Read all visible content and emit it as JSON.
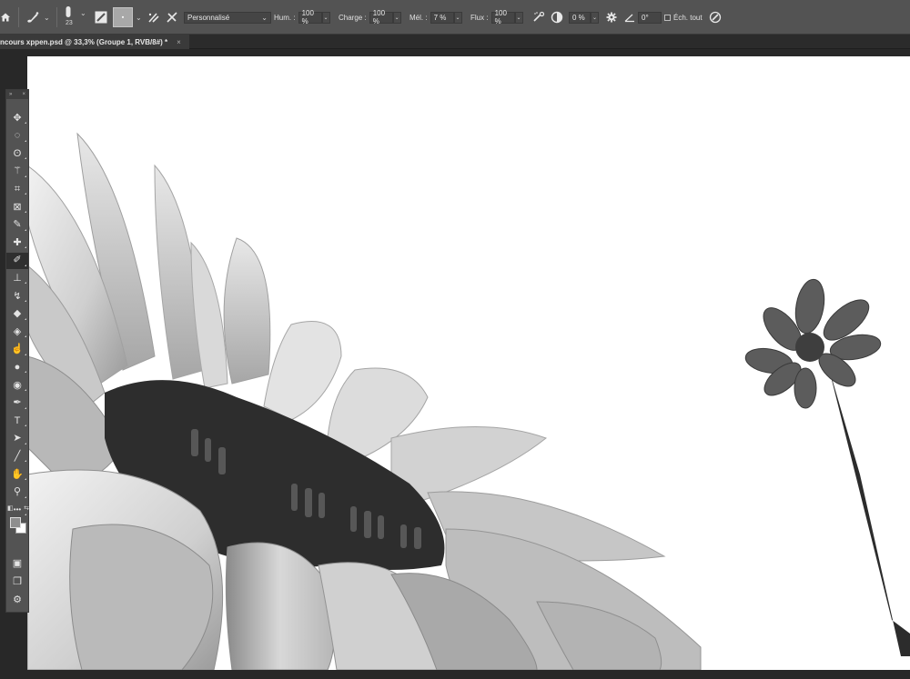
{
  "options_bar": {
    "brush_size": "23",
    "brush_preset": "Personnalisé",
    "humidity_label": "Hum. :",
    "humidity_value": "100 %",
    "load_label": "Charge :",
    "load_value": "100 %",
    "mix_label": "Mél. :",
    "mix_value": "7 %",
    "flow_label": "Flux :",
    "flow_value": "100 %",
    "smoothing_value": "0 %",
    "angle_value": "0°",
    "sample_all_label": "Éch. tout"
  },
  "document_tab": {
    "title": "ncours xppen.psd @ 33,3% (Groupe 1, RVB/8#) *",
    "close": "×"
  },
  "tools_panel": {
    "tools": [
      {
        "name": "move-tool-icon",
        "glyph": "✥"
      },
      {
        "name": "ellipse-marquee-tool-icon",
        "glyph": "◌"
      },
      {
        "name": "lasso-tool-icon",
        "glyph": "ʘ"
      },
      {
        "name": "magic-wand-tool-icon",
        "glyph": "⚚"
      },
      {
        "name": "crop-tool-icon",
        "glyph": "⌗"
      },
      {
        "name": "frame-tool-icon",
        "glyph": "⊠"
      },
      {
        "name": "eyedropper-tool-icon",
        "glyph": "✎"
      },
      {
        "name": "healing-brush-tool-icon",
        "glyph": "✚"
      },
      {
        "name": "mixer-brush-tool-icon",
        "glyph": "✐"
      },
      {
        "name": "clone-stamp-tool-icon",
        "glyph": "⊥"
      },
      {
        "name": "history-brush-tool-icon",
        "glyph": "↯"
      },
      {
        "name": "eraser-tool-icon",
        "glyph": "◆"
      },
      {
        "name": "paint-bucket-tool-icon",
        "glyph": "◈"
      },
      {
        "name": "smudge-tool-icon",
        "glyph": "☝"
      },
      {
        "name": "dodge-tool-icon",
        "glyph": "●"
      },
      {
        "name": "sponge-tool-icon",
        "glyph": "◉"
      },
      {
        "name": "pen-tool-icon",
        "glyph": "✒"
      },
      {
        "name": "type-tool-icon",
        "glyph": "T"
      },
      {
        "name": "path-selection-tool-icon",
        "glyph": "➤"
      },
      {
        "name": "line-tool-icon",
        "glyph": "╱"
      },
      {
        "name": "hand-tool-icon",
        "glyph": "✋"
      },
      {
        "name": "zoom-tool-icon",
        "glyph": "⚲"
      },
      {
        "name": "more-tools-icon",
        "glyph": "•••"
      }
    ],
    "bottom_tools": [
      {
        "name": "quick-mask-icon",
        "glyph": "▣"
      },
      {
        "name": "screen-mode-icon",
        "glyph": "❐"
      },
      {
        "name": "edit-toolbar-icon",
        "glyph": "⚙"
      }
    ]
  },
  "colors": {
    "foreground": "#8e8e8e",
    "background": "#ffffff",
    "options_bar": "#535353",
    "workspace": "#282828"
  }
}
